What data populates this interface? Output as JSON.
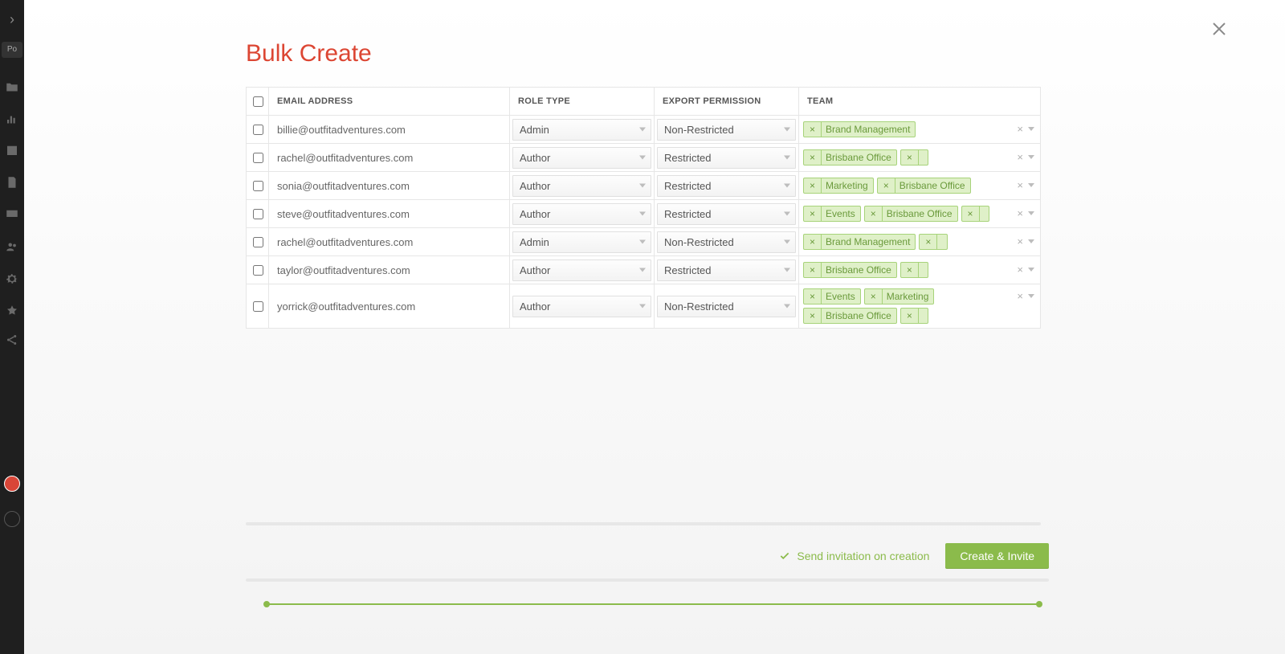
{
  "sidebar": {
    "chevron": "›",
    "badge": "Po"
  },
  "modal": {
    "title": "Bulk Create",
    "headers": {
      "email": "EMAIL ADDRESS",
      "role": "ROLE TYPE",
      "export": "EXPORT PERMISSION",
      "team": "TEAM"
    },
    "rows": [
      {
        "email": "billie@outfitadventures.com",
        "role": "Admin",
        "export": "Non-Restricted",
        "teams": [
          "Brand Management"
        ],
        "trailingEmpty": false
      },
      {
        "email": "rachel@outfitadventures.com",
        "role": "Author",
        "export": "Restricted",
        "teams": [
          "Brisbane Office"
        ],
        "trailingEmpty": true
      },
      {
        "email": "sonia@outfitadventures.com",
        "role": "Author",
        "export": "Restricted",
        "teams": [
          "Marketing",
          "Brisbane Office"
        ],
        "trailingEmpty": false
      },
      {
        "email": "steve@outfitadventures.com",
        "role": "Author",
        "export": "Restricted",
        "teams": [
          "Events",
          "Brisbane Office"
        ],
        "trailingEmpty": true
      },
      {
        "email": "rachel@outfitadventures.com",
        "role": "Admin",
        "export": "Non-Restricted",
        "teams": [
          "Brand Management"
        ],
        "trailingEmpty": true
      },
      {
        "email": "taylor@outfitadventures.com",
        "role": "Author",
        "export": "Restricted",
        "teams": [
          "Brisbane Office"
        ],
        "trailingEmpty": true
      },
      {
        "email": "yorrick@outfitadventures.com",
        "role": "Author",
        "export": "Non-Restricted",
        "teams": [
          "Events",
          "Marketing",
          "Brisbane Office"
        ],
        "trailingEmpty": true
      }
    ],
    "inviteLabel": "Send invitation on creation",
    "submitLabel": "Create & Invite"
  }
}
